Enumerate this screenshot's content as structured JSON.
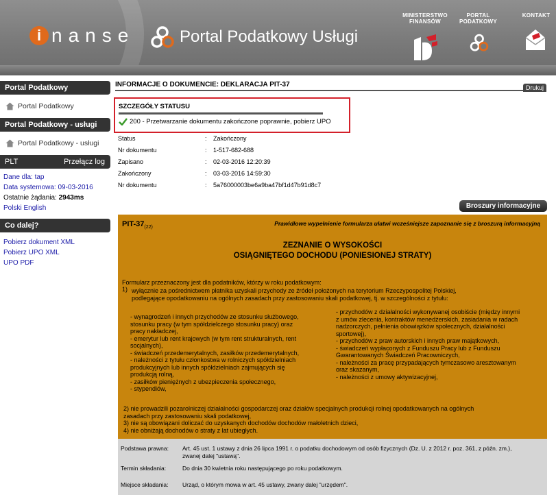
{
  "header": {
    "logo_letter": "i",
    "logo_text": "nanse",
    "portal_title": "Portal Podatkowy Usługi",
    "links": [
      {
        "line1": "MINISTERSTWO",
        "line2": "FINANSÓW"
      },
      {
        "line1": "PORTAL",
        "line2": "PODATKOWY"
      },
      {
        "line1": "KONTAKT",
        "line2": ""
      }
    ]
  },
  "sidebar": {
    "sections": [
      {
        "title": "Portal Podatkowy",
        "item": "Portal Podatkowy"
      },
      {
        "title": "Portal Podatkowy - usługi",
        "item": "Portal Podatkowy - usługi"
      }
    ],
    "plt": {
      "title": "PLT",
      "switch_log": "Przełącz log",
      "data_for_label": "Dane dla: ",
      "data_for_value": "tap",
      "system_date_label": "Data systemowa: ",
      "system_date_value": "09-03-2016",
      "last_requests_label": "Ostatnie żądania: ",
      "last_requests_value": "2943ms",
      "lang_pl": "Polski",
      "lang_en": "English"
    },
    "next": {
      "title": "Co dalej?",
      "links": [
        "Pobierz dokument XML",
        "Pobierz UPO XML",
        "UPO PDF"
      ]
    }
  },
  "main": {
    "doc_title": "INFORMACJE O DOKUMENCIE: DEKLARACJA PIT-37",
    "print_label": "Drukuj",
    "status_box": {
      "title": "SZCZEGÓŁY STATUSU",
      "message": "200 - Przetwarzanie dokumentu zakończone poprawnie, pobierz UPO"
    },
    "details": [
      {
        "label": "Status",
        "value": "Zakończony"
      },
      {
        "label": "Nr dokumentu",
        "value": "1-517-682-688"
      },
      {
        "label": "Zapisano",
        "value": "02-03-2016 12:20:39"
      },
      {
        "label": "Zakończony",
        "value": "03-03-2016 14:59:30"
      },
      {
        "label": "Nr dokumentu",
        "value": "5a76000003be6a9ba47bf1d47b91d8c7"
      }
    ],
    "brochure_button": "Broszury informacyjne"
  },
  "form": {
    "pit_code": "PIT-37",
    "pit_version": "(22)",
    "hint": "Prawidłowe wypełnienie formularza ułatwi wcześniejsze zapoznanie się z broszurą informacyjną",
    "title_line1": "ZEZNANIE O WYSOKOŚCI",
    "title_line2": "OSIĄGNIĘTEGO DOCHODU (PONIESIONEJ STRATY)",
    "intro": "Formularz przeznaczony jest dla podatników, którzy w roku podatkowym:",
    "point1_num": "1)",
    "point1_line1": "wyłącznie za pośrednictwem płatnika uzyskali przychody ze źródeł położonych na terytorium Rzeczypospolitej Polskiej,",
    "point1_line2": "podlegające opodatkowaniu na ogólnych zasadach przy zastosowaniu skali podatkowej, tj. w szczególności z tytułu:",
    "left_col": "- wynagrodzeń i innych przychodów ze stosunku służbowego,\nstosunku pracy (w tym spółdzielczego stosunku pracy) oraz\npracy nakładczej,\n- emerytur lub rent krajowych (w tym rent strukturalnych, rent\nsocjalnych),\n- świadczeń przedemerytalnych, zasiłków przedemerytalnych,\n- należności z tytułu członkostwa w rolniczych spółdzielniach\nprodukcyjnych lub innych spółdzielniach zajmujących się\nprodukcją rolną,\n- zasiłków pieniężnych z ubezpieczenia społecznego,\n- stypendiów,",
    "right_col": "- przychodów z działalności wykonywanej osobiście (między innymi\nz umów zlecenia, kontraktów menedżerskich, zasiadania w radach\nnadzorczych, pełnienia obowiązków społecznych, działalności\nsportowej),\n- przychodów z praw autorskich i innych praw majątkowych,\n- świadczeń wypłaconych z Funduszu Pracy lub z Funduszu\nGwarantowanych Świadczeń Pracowniczych,\n- należności za pracę przypadających tymczasowo aresztowanym\noraz skazanym,\n- należności z umowy aktywizacyjnej,",
    "points_rest": "2) nie prowadzili pozarolniczej działalności gospodarczej oraz działów specjalnych produkcji rolnej opodatkowanych na ogólnych\n     zasadach przy zastosowaniu skali podatkowej,\n3) nie są obowiązani doliczać do uzyskanych dochodów dochodów małoletnich dzieci,\n4) nie obniżają dochodów o straty z lat ubiegłych."
  },
  "bottom": {
    "rows": [
      {
        "label": "Podstawa prawna:",
        "value": "Art. 45 ust. 1 ustawy z dnia 26 lipca 1991 r. o podatku dochodowym od osób fizycznych (Dz. U. z 2012 r. poz. 361, z późn. zm.),\nzwanej dalej \"ustawą\"."
      },
      {
        "label": "Termin składania:",
        "value": "Do dnia 30 kwietnia roku następującego po roku podatkowym."
      },
      {
        "label": "Miejsce składania:",
        "value": "Urząd, o którym mowa w art. 45 ustawy, zwany dalej \"urzędem\"."
      }
    ]
  }
}
